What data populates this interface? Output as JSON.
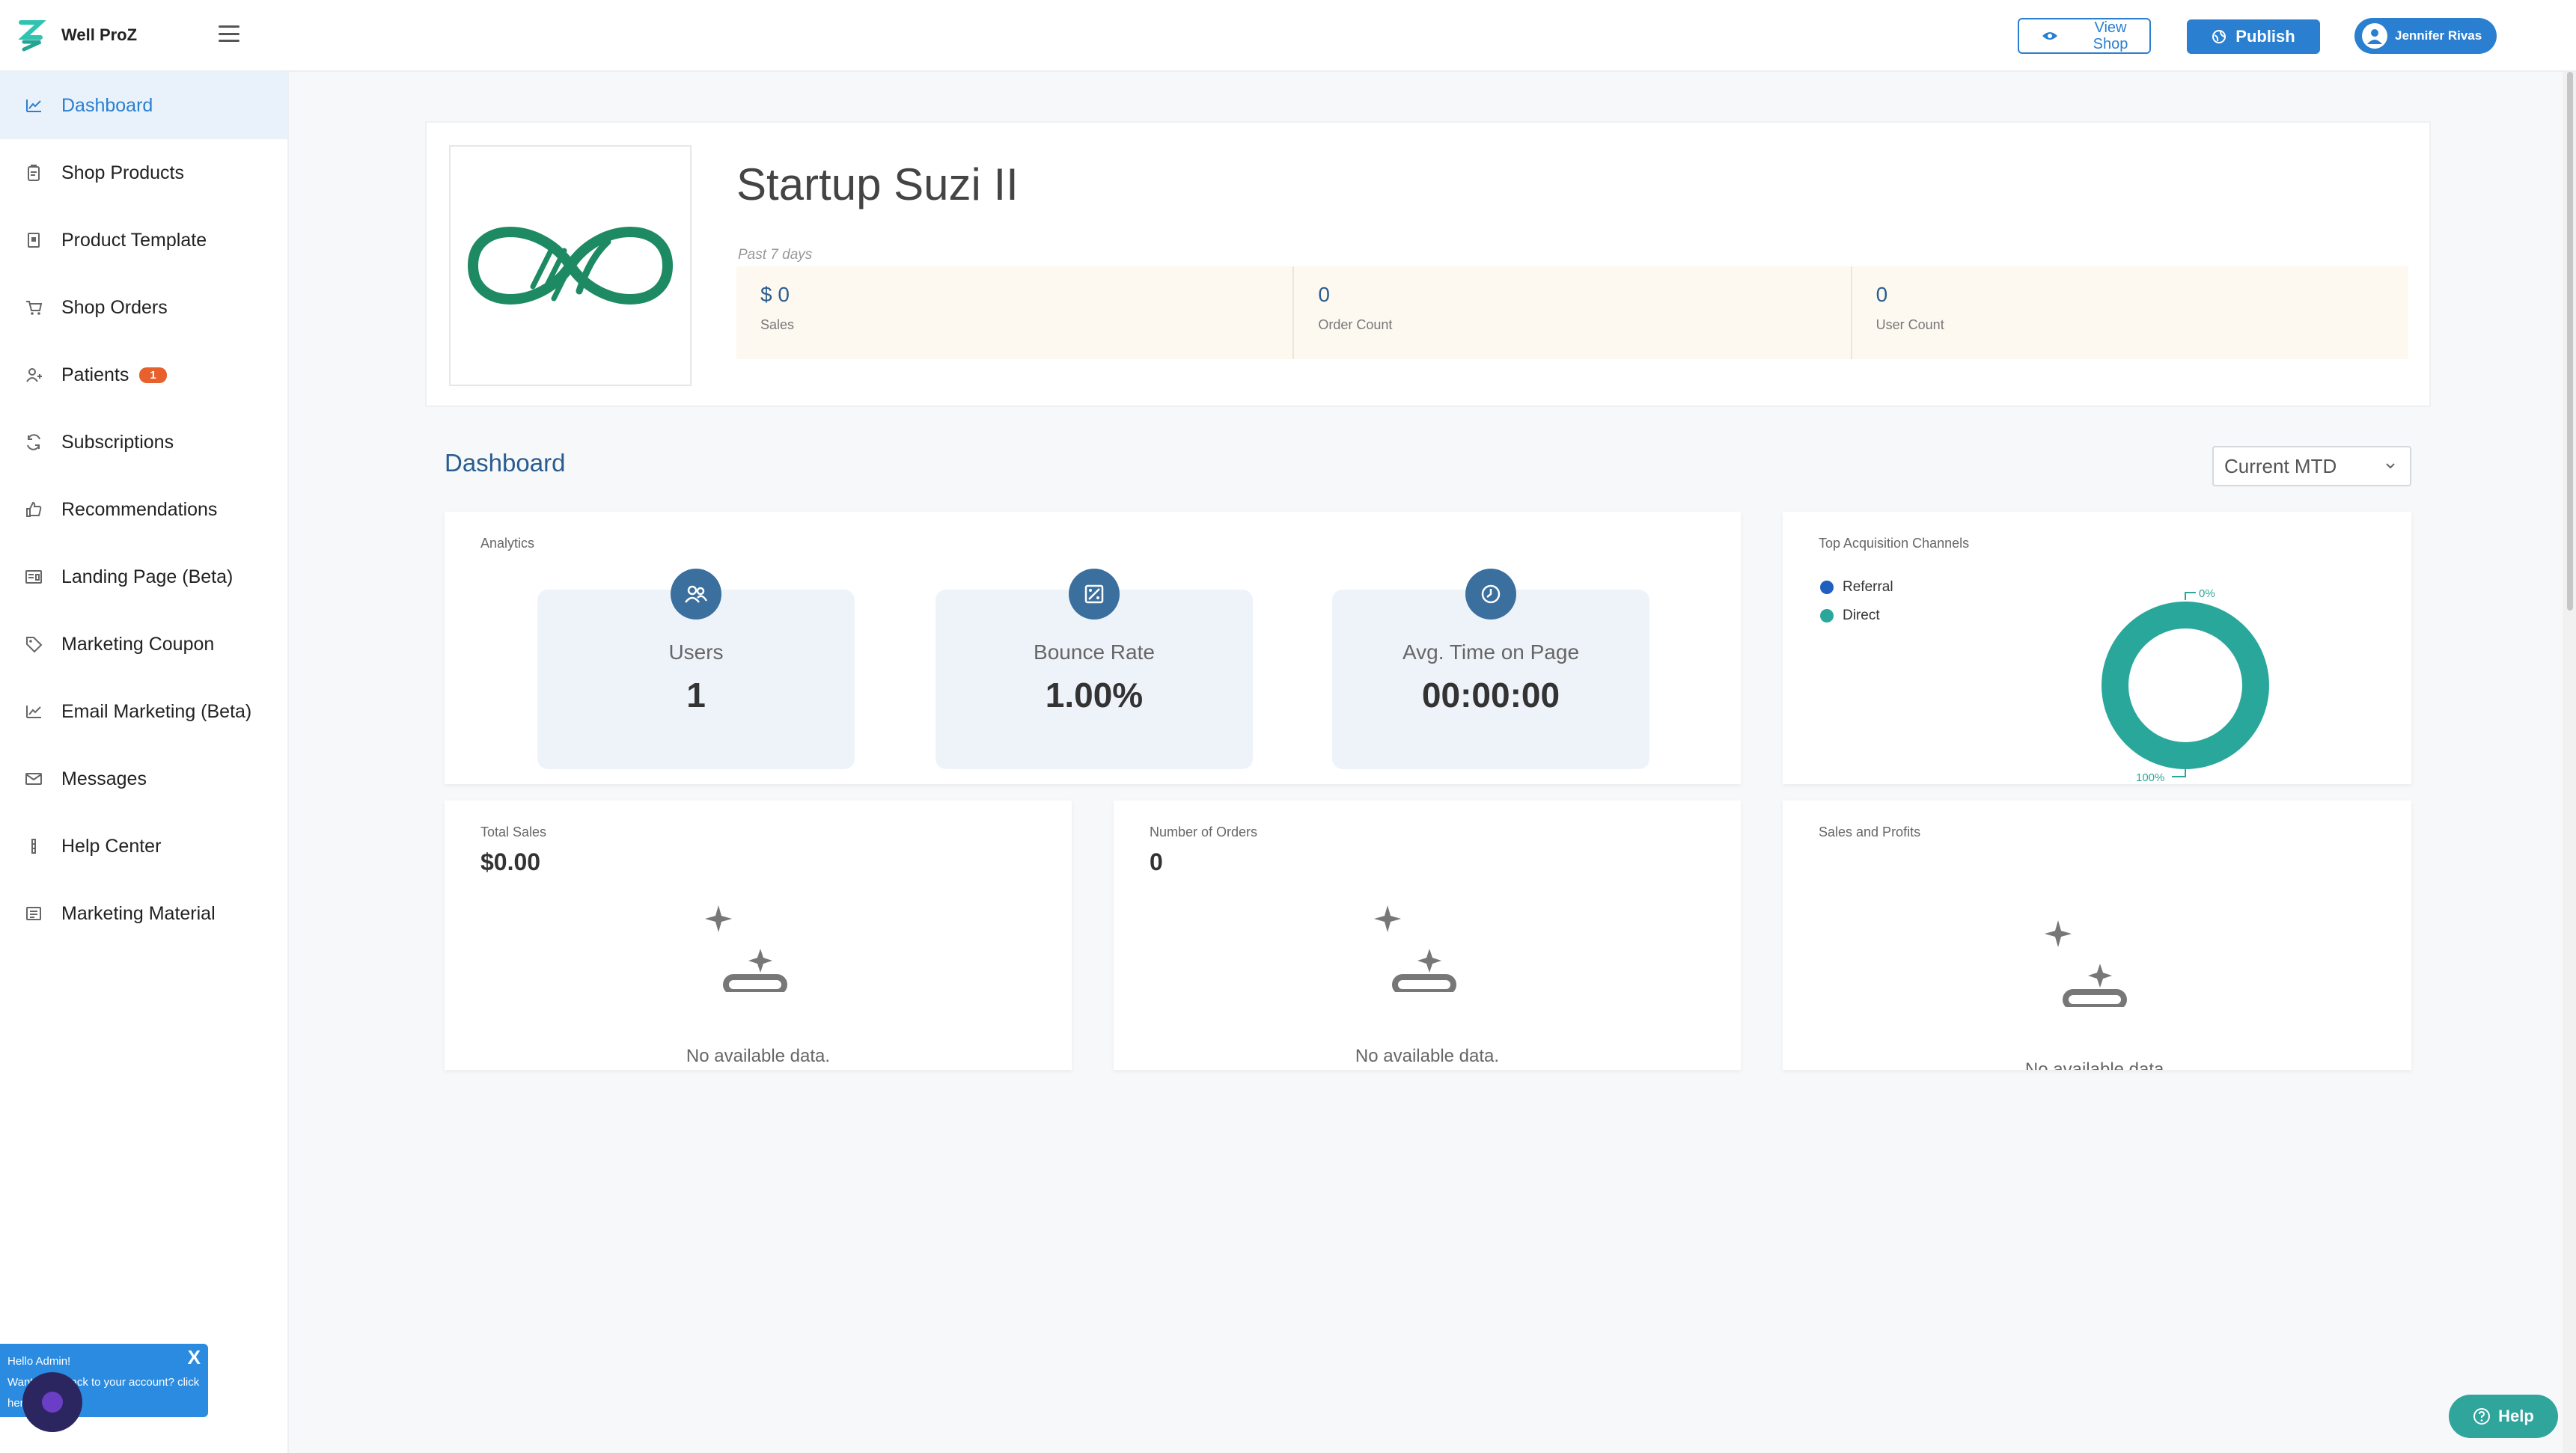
{
  "app": {
    "name": "Well ProZ"
  },
  "header": {
    "view_shop_label": "View Shop",
    "view_shop_line1": "View",
    "view_shop_line2": "Shop",
    "publish_label": "Publish",
    "user_name": "Jennifer Rivas"
  },
  "sidebar": {
    "items": [
      {
        "label": "Dashboard",
        "icon": "chart-line-icon",
        "active": true
      },
      {
        "label": "Shop Products",
        "icon": "clipboard-icon"
      },
      {
        "label": "Product Template",
        "icon": "template-icon"
      },
      {
        "label": "Shop Orders",
        "icon": "cart-icon"
      },
      {
        "label": "Patients",
        "icon": "patients-icon",
        "badge": "1"
      },
      {
        "label": "Subscriptions",
        "icon": "refresh-icon"
      },
      {
        "label": "Recommendations",
        "icon": "thumbs-up-icon"
      },
      {
        "label": "Landing Page (Beta)",
        "icon": "landing-page-icon"
      },
      {
        "label": "Marketing Coupon",
        "icon": "tag-icon"
      },
      {
        "label": "Email Marketing (Beta)",
        "icon": "chart-line-icon"
      },
      {
        "label": "Messages",
        "icon": "envelope-icon"
      },
      {
        "label": "Help Center",
        "icon": "help-center-icon"
      },
      {
        "label": "Marketing Material",
        "icon": "document-icon"
      }
    ]
  },
  "shop": {
    "title": "Startup Suzi II",
    "period": "Past 7 days",
    "stats": [
      {
        "value": "$ 0",
        "label": "Sales"
      },
      {
        "value": "0",
        "label": "Order Count"
      },
      {
        "value": "0",
        "label": "User Count"
      }
    ]
  },
  "dashboard": {
    "title": "Dashboard",
    "range_select": "Current MTD",
    "analytics": {
      "label": "Analytics",
      "metrics": [
        {
          "name": "Users",
          "value": "1",
          "icon": "users-icon"
        },
        {
          "name": "Bounce Rate",
          "value": "1.00%",
          "icon": "bounce-rate-icon"
        },
        {
          "name": "Avg. Time on Page",
          "value": "00:00:00",
          "icon": "clock-icon"
        }
      ]
    },
    "acquisition": {
      "label": "Top Acquisition Channels",
      "legend": [
        {
          "name": "Referral",
          "color": "#1f5fbf"
        },
        {
          "name": "Direct",
          "color": "#2aa79b"
        }
      ],
      "top_label": "0%",
      "bottom_label": "100%"
    },
    "total_sales": {
      "label": "Total Sales",
      "value": "$0.00",
      "empty": "No available data."
    },
    "orders": {
      "label": "Number of Orders",
      "value": "0",
      "empty": "No available data."
    },
    "sales_profits": {
      "label": "Sales and Profits",
      "empty": "No available data."
    }
  },
  "chart_data": {
    "type": "pie",
    "title": "Top Acquisition Channels",
    "categories": [
      "Referral",
      "Direct"
    ],
    "values": [
      0,
      100
    ],
    "colors": [
      "#1f5fbf",
      "#2aa79b"
    ],
    "legend": "top-left"
  },
  "toast": {
    "line1": "Hello Admin!",
    "line2": "Want to go back to your account? click",
    "line3": "here"
  },
  "help": {
    "label": "Help"
  },
  "colors": {
    "primary": "#2a7fd0",
    "accent": "#2aa79b",
    "badge": "#e8602c"
  }
}
